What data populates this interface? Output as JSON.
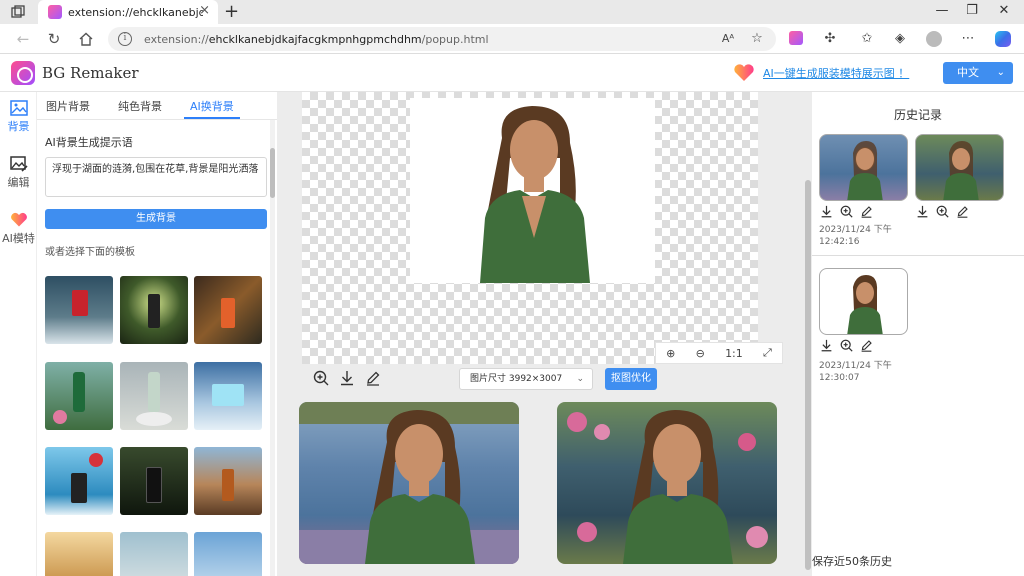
{
  "browser": {
    "tab_title": "extension://ehcklkanebjdkajfacgkmpnhgpmchdhm/popup.html",
    "tab_close": "×",
    "new_tab": "+",
    "url_scheme": "extension://",
    "url_host": "ehcklkanebjdkajfacgkmpnhgpmchdhm",
    "url_path": "/popup.html",
    "window_buttons": [
      "—",
      "❐",
      "✕"
    ]
  },
  "app": {
    "title": "BG Remaker",
    "promo_link": "AI一键生成服装模特展示图 ！",
    "language": "中文"
  },
  "side_nav": [
    {
      "label": "背景",
      "icon": "image-icon",
      "active": true
    },
    {
      "label": "编辑",
      "icon": "edit-image-icon",
      "active": false
    },
    {
      "label": "AI模特",
      "icon": "heart-icon",
      "active": false
    }
  ],
  "left_panel": {
    "tabs": [
      "图片背景",
      "纯色背景",
      "AI换背景"
    ],
    "active_tab": 2,
    "prompt_label": "AI背景生成提示语",
    "prompt_value": "浮现于湖面的涟漪,包围在花草,背景是阳光洒落",
    "generate_button": "生成背景",
    "template_label": "或者选择下面的模板"
  },
  "center": {
    "zoom_in": "⊕",
    "zoom_out": "⊖",
    "zoom_ratio": "1:1",
    "fullscreen": "⤢",
    "size_label": "图片尺寸 3992×3007",
    "optimize_button": "抠图优化"
  },
  "history": {
    "title": "历史记录",
    "items": [
      {
        "time": "2023/11/24 下午\n12:42:16"
      },
      {
        "time": "2023/11/24 下午\n12:30:07"
      }
    ],
    "footer": "保存近50条历史"
  },
  "colors": {
    "accent": "#3f8ef0",
    "link": "#1e88e5"
  }
}
